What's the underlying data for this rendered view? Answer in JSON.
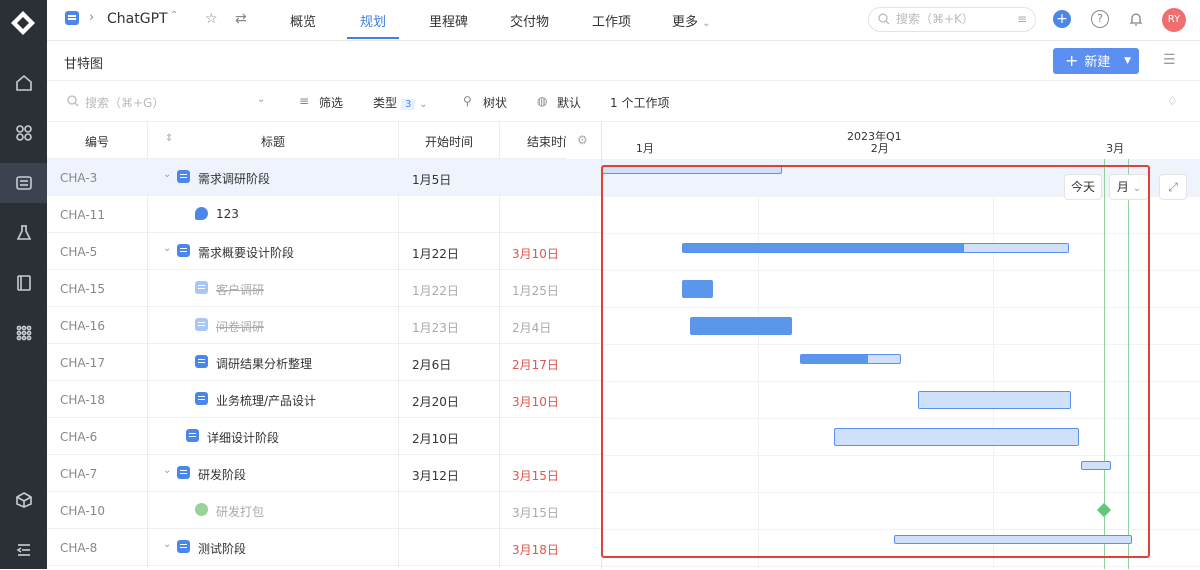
{
  "topbar": {
    "project_name": "ChatGPT",
    "tabs": [
      "概览",
      "规划",
      "里程碑",
      "交付物",
      "工作项",
      "更多"
    ],
    "active_tab": "规划",
    "search_placeholder": "搜索（⌘+K）",
    "avatar_initials": "RY"
  },
  "page": {
    "title": "甘特图",
    "new_button": "新建"
  },
  "filterbar": {
    "search_placeholder": "搜索（⌘+G）",
    "filter_label": "筛选",
    "type_label": "类型",
    "type_count": "3",
    "tree_label": "树状",
    "default_label": "默认",
    "count_label": "1 个工作项"
  },
  "grid": {
    "columns": [
      "编号",
      "标题",
      "开始时间",
      "结束时间"
    ],
    "rows": [
      {
        "id": "CHA-3",
        "title": "需求调研阶段",
        "start": "1月5日",
        "end": "",
        "end_red": false,
        "style": "normal",
        "icon": "task",
        "indent": 0,
        "caret": true,
        "selected": true
      },
      {
        "id": "CHA-11",
        "title": "123",
        "start": "",
        "end": "",
        "end_red": false,
        "style": "normal",
        "icon": "bug",
        "indent": 1,
        "caret": false,
        "selected": false
      },
      {
        "id": "CHA-5",
        "title": "需求概要设计阶段",
        "start": "1月22日",
        "end": "3月10日",
        "end_red": true,
        "style": "normal",
        "icon": "task",
        "indent": 0,
        "caret": true,
        "selected": false
      },
      {
        "id": "CHA-15",
        "title": "客户调研",
        "start": "1月22日",
        "end": "1月25日",
        "end_red": false,
        "style": "strike",
        "icon": "task-faded",
        "indent": 1,
        "caret": false,
        "selected": false
      },
      {
        "id": "CHA-16",
        "title": "问卷调研",
        "start": "1月23日",
        "end": "2月4日",
        "end_red": false,
        "style": "strike",
        "icon": "task-faded",
        "indent": 1,
        "caret": false,
        "selected": false
      },
      {
        "id": "CHA-17",
        "title": "调研结果分析整理",
        "start": "2月6日",
        "end": "2月17日",
        "end_red": true,
        "style": "normal",
        "icon": "task",
        "indent": 1,
        "caret": false,
        "selected": false
      },
      {
        "id": "CHA-18",
        "title": "业务梳理/产品设计",
        "start": "2月20日",
        "end": "3月10日",
        "end_red": true,
        "style": "normal",
        "icon": "task",
        "indent": 1,
        "caret": false,
        "selected": false
      },
      {
        "id": "CHA-6",
        "title": "详细设计阶段",
        "start": "2月10日",
        "end": "",
        "end_red": false,
        "style": "normal",
        "icon": "task",
        "indent": 0.5,
        "caret": false,
        "selected": false
      },
      {
        "id": "CHA-7",
        "title": "研发阶段",
        "start": "3月12日",
        "end": "3月15日",
        "end_red": true,
        "style": "normal",
        "icon": "task",
        "indent": 0,
        "caret": true,
        "selected": false
      },
      {
        "id": "CHA-10",
        "title": "研发打包",
        "start": "",
        "end": "3月15日",
        "end_red": false,
        "style": "dim",
        "icon": "ok",
        "indent": 1,
        "caret": false,
        "selected": false
      },
      {
        "id": "CHA-8",
        "title": "测试阶段",
        "start": "",
        "end": "3月18日",
        "end_red": true,
        "style": "normal",
        "icon": "task",
        "indent": 0,
        "caret": true,
        "selected": false
      }
    ]
  },
  "gantt": {
    "quarter_label": "2023年Q1",
    "months": [
      "1月",
      "2月",
      "3月"
    ],
    "today_button": "今天",
    "scale_button": "月",
    "bars": [
      {
        "row": 0,
        "start": 0.0,
        "end": 0.3,
        "kind": "outline"
      },
      {
        "row": 2,
        "start": 0.134,
        "end": 0.78,
        "kind": "progress",
        "progress": 0.73
      },
      {
        "row": 3,
        "start": 0.134,
        "end": 0.185,
        "kind": "solid"
      },
      {
        "row": 4,
        "start": 0.147,
        "end": 0.318,
        "kind": "solid"
      },
      {
        "row": 5,
        "start": 0.331,
        "end": 0.5,
        "kind": "progress",
        "progress": 0.67
      },
      {
        "row": 6,
        "start": 0.528,
        "end": 0.783,
        "kind": "light"
      },
      {
        "row": 7,
        "start": 0.387,
        "end": 0.796,
        "kind": "light"
      },
      {
        "row": 8,
        "start": 0.799,
        "end": 0.85,
        "kind": "outline"
      },
      {
        "row": 10,
        "start": 0.488,
        "end": 0.885,
        "kind": "outline"
      }
    ],
    "milestone_row": 9,
    "milestone_pos": 0.838,
    "today_pos": 0.838
  }
}
